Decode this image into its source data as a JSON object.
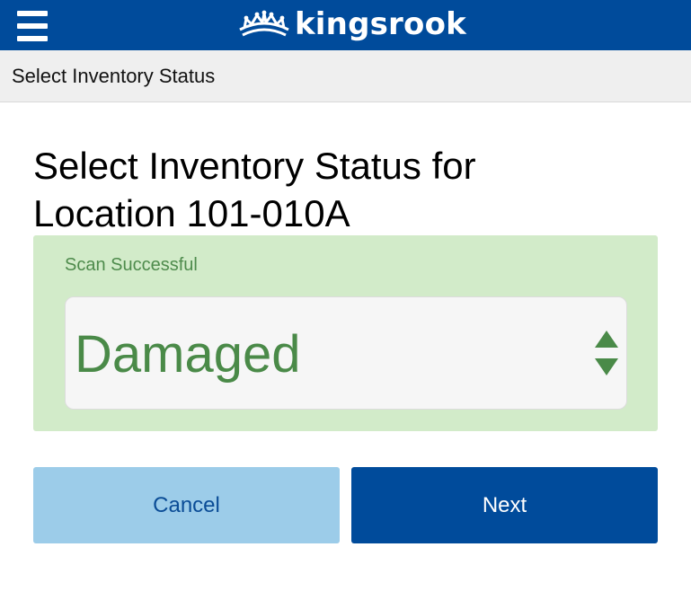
{
  "header": {
    "brand_name": "kingsrook",
    "menu_icon": "hamburger-menu-icon",
    "logo_icon": "crown-logo-icon",
    "background_color": "#004b9b"
  },
  "subheader": {
    "title": "Select Inventory Status"
  },
  "main": {
    "title_line1": "Select Inventory Status for",
    "title_line2": "Location 101-010A"
  },
  "scan": {
    "message": "Scan Successful",
    "panel_color": "#d2ebc9",
    "text_color": "#4a8a48"
  },
  "status_select": {
    "selected_value": "Damaged",
    "arrows_icon": "up-down-arrows-icon"
  },
  "actions": {
    "cancel_label": "Cancel",
    "next_label": "Next",
    "cancel_color": "#9ccce9",
    "next_color": "#004b9b"
  }
}
